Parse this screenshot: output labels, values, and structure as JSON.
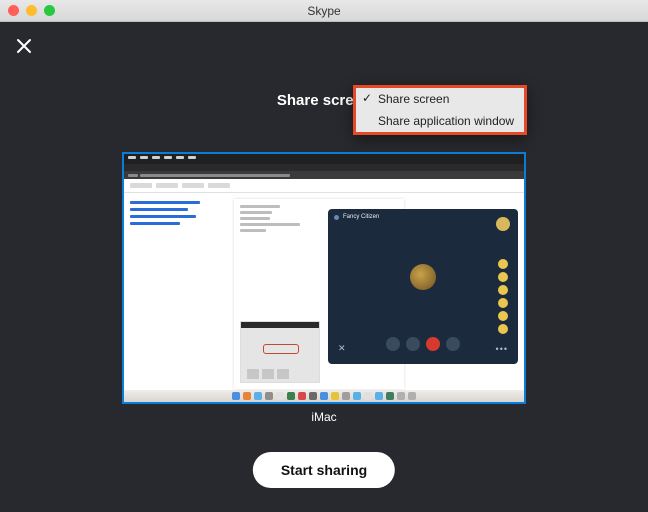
{
  "window": {
    "title": "Skype"
  },
  "share_panel": {
    "heading": "Share screen",
    "dropdown": {
      "options": [
        {
          "label": "Share screen",
          "selected": true
        },
        {
          "label": "Share application window",
          "selected": false
        }
      ]
    },
    "screen_label": "iMac",
    "start_button": "Start sharing"
  },
  "call_preview": {
    "participant_name": "Fancy Citizen"
  }
}
